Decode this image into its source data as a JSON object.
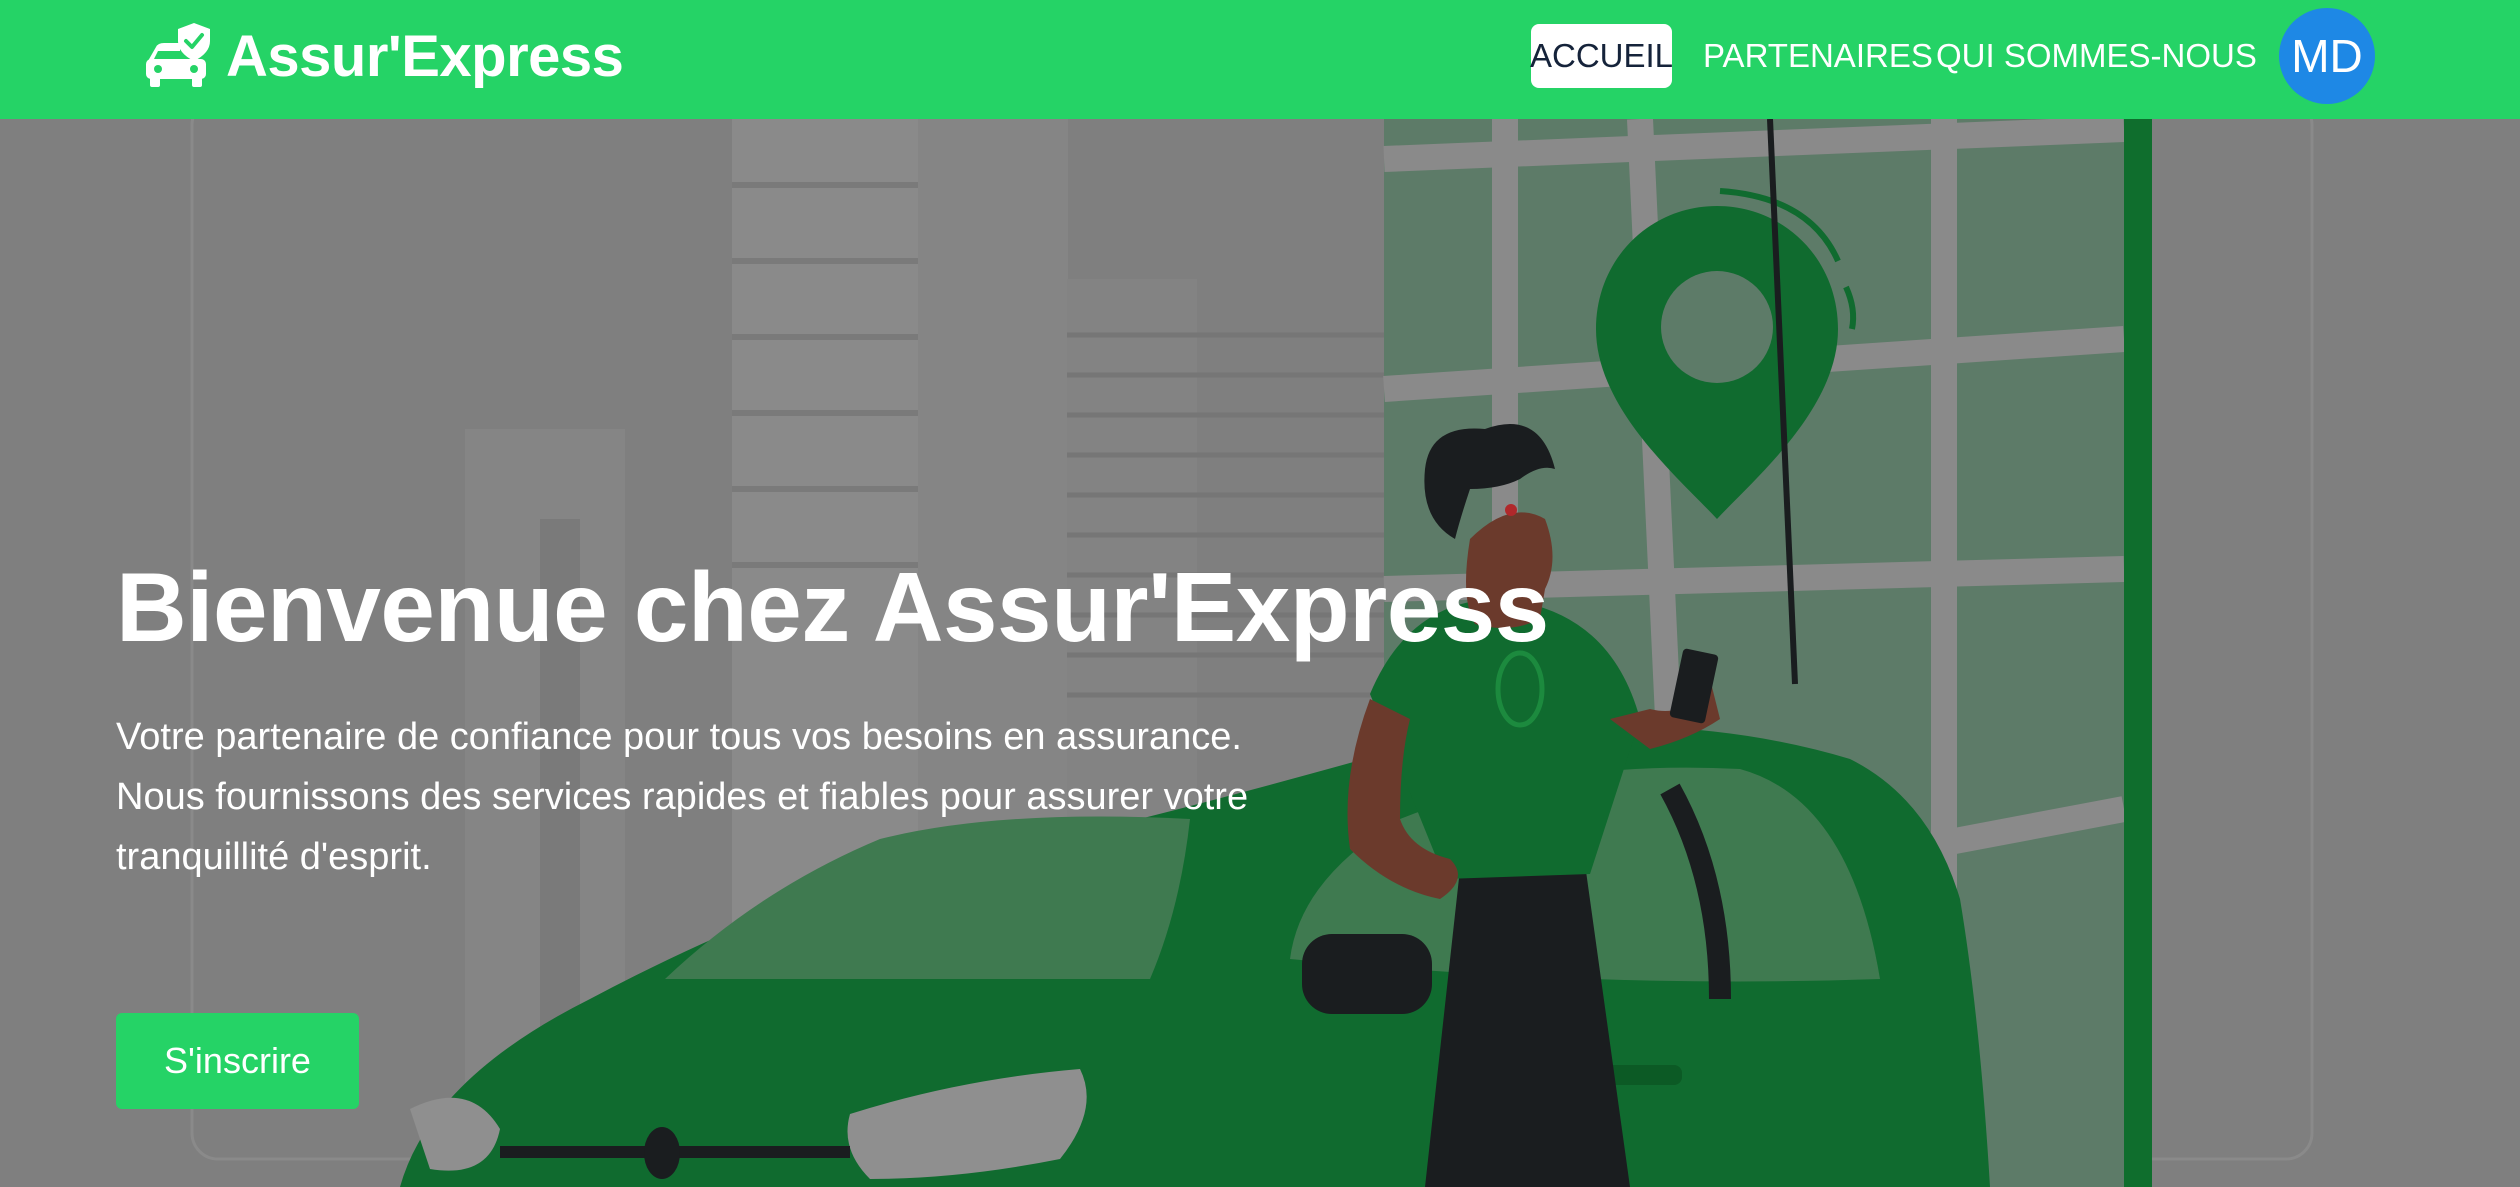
{
  "navbar": {
    "brand": "Assur'Express",
    "brand_icon": "car-shield-icon",
    "links": [
      {
        "label": "ACCUEIL",
        "active": true
      },
      {
        "label": "PARTENAIRES",
        "active": false
      },
      {
        "label": "QUI SOMMES-NOUS",
        "active": false
      }
    ],
    "avatar_initials": "MD"
  },
  "hero": {
    "title": "Bienvenue chez Assur'Express",
    "description": "Votre partenaire de confiance pour tous vos besoins en assurance. Nous fournissons des services rapides et fiables pour assurer votre tranquillité d'esprit.",
    "cta_label": "S'inscrire",
    "illustration": "man-with-phone-leaning-on-green-car"
  },
  "colors": {
    "brand_green": "#25d366",
    "avatar_blue": "#1e88e5",
    "overlay_gray": "#7f7f7f"
  }
}
